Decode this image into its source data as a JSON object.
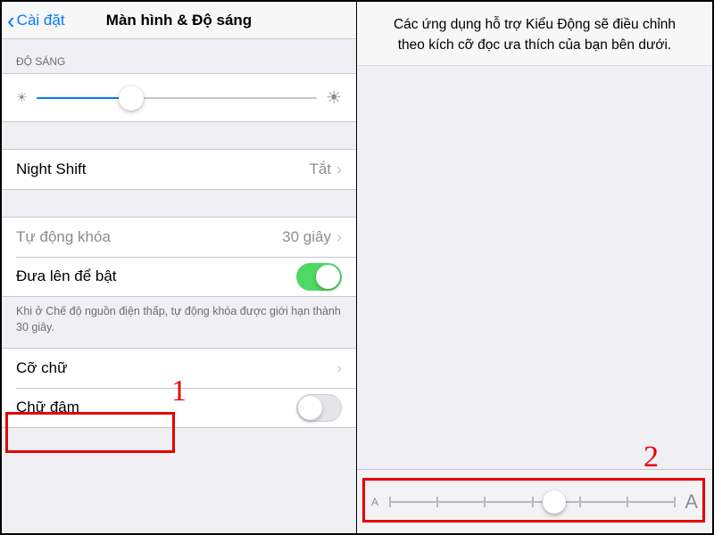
{
  "left": {
    "back_label": "Cài đặt",
    "title": "Màn hình & Độ sáng",
    "brightness_section": "ĐỘ SÁNG",
    "brightness_value_pct": 34,
    "night_shift": {
      "label": "Night Shift",
      "value": "Tắt"
    },
    "auto_lock": {
      "label": "Tự động khóa",
      "value": "30 giây"
    },
    "raise_to_wake": {
      "label": "Đưa lên để bật",
      "on": true
    },
    "low_power_note": "Khi ở Chế độ nguồn điện thấp, tự động khóa được giới hạn thành 30 giây.",
    "text_size": {
      "label": "Cỡ chữ"
    },
    "bold_text": {
      "label": "Chữ đậm",
      "on": false
    },
    "step_number": "1"
  },
  "right": {
    "description": "Các ứng dụng hỗ trợ Kiểu Động sẽ điều chỉnh theo kích cỡ đọc ưa thích của bạn bên dưới.",
    "letter_small": "A",
    "letter_large": "A",
    "slider_stops": 7,
    "slider_position_pct": 58,
    "step_number": "2"
  }
}
